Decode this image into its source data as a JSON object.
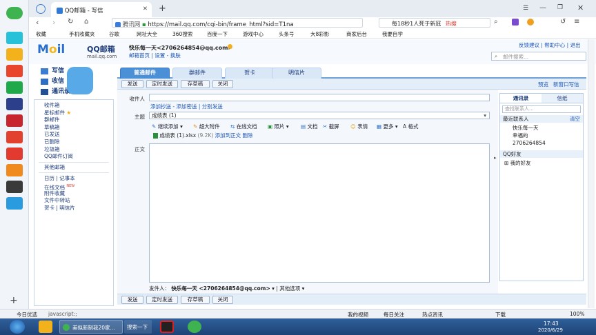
{
  "browser": {
    "tab1": "QQ邮箱 - 写信",
    "address": "https://mail.qq.com/cgi-bin/frame_html?sid=T1na",
    "site_tag": "腾讯网",
    "search_text": "每18秒1人死于新冠",
    "search_badge": "热搜",
    "bookmarks": [
      "收藏",
      "手机收藏夹",
      "谷歌",
      "网址大全",
      "360搜索",
      "百度一下",
      "游戏中心",
      "头条号",
      "大8彩影",
      "商家后台",
      "我要自学"
    ],
    "statusbar_left": "今日优选",
    "statusbar_url": "javascript:;",
    "statusbar_items": [
      "我的视频",
      "每日关注",
      "热点资讯",
      "下载"
    ],
    "zoom": "100%"
  },
  "mail": {
    "logo_text": "QQ邮箱",
    "logo_sub": "mail.qq.com",
    "user": "快乐每一天<2706264854@qq.com>",
    "user_links": [
      "邮箱首页",
      "设置",
      "换肤"
    ],
    "top_links": [
      "反馈建议",
      "帮助中心",
      "退出"
    ],
    "search_placeholder": "邮件搜索...",
    "nav_top": [
      "写信",
      "收信",
      "通讯录"
    ],
    "nav_items": [
      "收件箱",
      "星标邮件",
      "群邮件",
      "草稿箱",
      "已发送",
      "已删除",
      "垃圾箱",
      "QQ邮件订阅"
    ],
    "nav_items2": [
      "其他邮箱"
    ],
    "nav_items3": [
      "日历 | 记事本",
      "在线文档",
      "附件收藏",
      "文件中转站",
      "贺卡 | 明信片"
    ],
    "nav_new_badge": "NEW",
    "compose_tabs": [
      "普通邮件",
      "群邮件",
      "贺卡",
      "明信片"
    ],
    "toolbar_buttons": [
      "发送",
      "定时发送",
      "存草稿",
      "关闭"
    ],
    "bottom_buttons": [
      "发送",
      "定时发送",
      "存草稿",
      "关闭"
    ],
    "right_links": [
      "预览",
      "新窗口写信"
    ],
    "to_label": "收件人",
    "to_links": [
      "添加抄送",
      "添加密送",
      "分别发送"
    ],
    "subject_label": "主题",
    "subject_value": "成绩表 (1)",
    "body_label": "正文",
    "format_tools": [
      "继续添加",
      "超大附件",
      "在线文档",
      "照片",
      "文档",
      "截屏",
      "表情",
      "更多",
      "格式"
    ],
    "attachment": "成绩表 (1).xlsx",
    "attachment_size": "(9.2K)",
    "attachment_links": [
      "添加到正文",
      "删除"
    ],
    "sender_label": "发件人：",
    "sender": "快乐每一天 <2706264854@qq.com>",
    "other_options": "其他选项",
    "contacts": {
      "tabs": [
        "通讯录",
        "信纸"
      ],
      "search_placeholder": "查找联系人...",
      "recent_label": "最近联系人",
      "clear": "清空",
      "recent": [
        "快乐每一天",
        "幸福的",
        "2706264854"
      ],
      "qq_friends": "QQ好友",
      "my_friends": "我的好友"
    }
  },
  "taskbar": {
    "items": [
      "美拟新制我20家...",
      "搜索一下"
    ],
    "time": "17:43",
    "date": "2020/6/29"
  }
}
